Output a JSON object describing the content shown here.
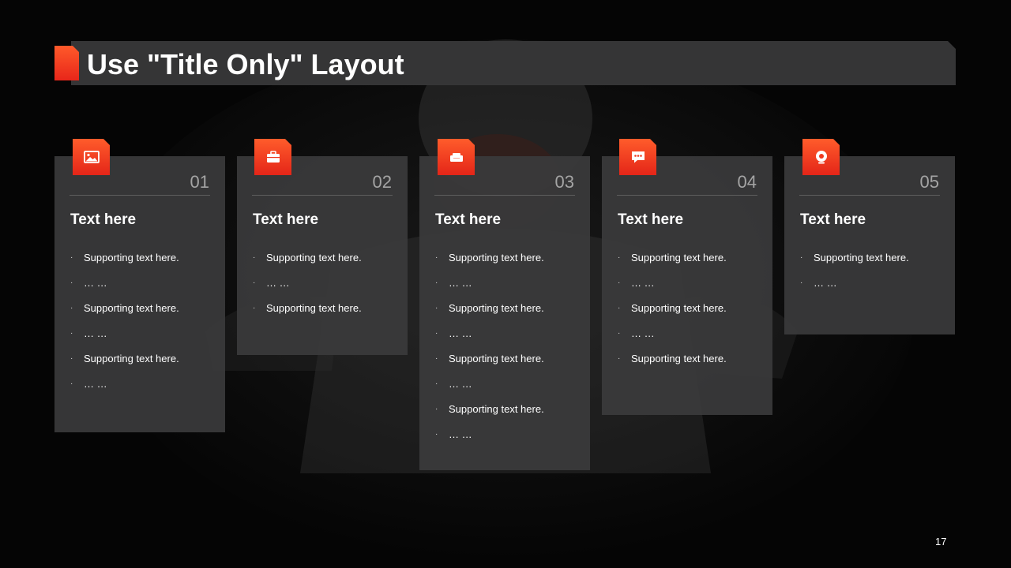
{
  "slide": {
    "title": "Use \"Title Only\" Layout",
    "page_number": "17",
    "accent_color": "#ff4a22",
    "cards": [
      {
        "number": "01",
        "heading": "Text here",
        "icon": "image-icon",
        "items": [
          "Supporting  text here.",
          "… …",
          "Supporting  text here.",
          "… …",
          "Supporting  text here.",
          "… …"
        ]
      },
      {
        "number": "02",
        "heading": "Text here",
        "icon": "briefcase-icon",
        "items": [
          "Supporting  text here.",
          "… …",
          "Supporting  text here."
        ]
      },
      {
        "number": "03",
        "heading": "Text here",
        "icon": "sofa-icon",
        "items": [
          "Supporting  text here.",
          "… …",
          "Supporting  text here.",
          "… …",
          "Supporting  text here.",
          "… …",
          "Supporting  text here.",
          "… …"
        ]
      },
      {
        "number": "04",
        "heading": "Text here",
        "icon": "chat-bubble-icon",
        "items": [
          "Supporting  text here.",
          "… …",
          "Supporting  text here.",
          "… …",
          "Supporting  text here."
        ]
      },
      {
        "number": "05",
        "heading": "Text here",
        "icon": "webcam-icon",
        "items": [
          "Supporting  text here.",
          "… …"
        ]
      }
    ]
  }
}
